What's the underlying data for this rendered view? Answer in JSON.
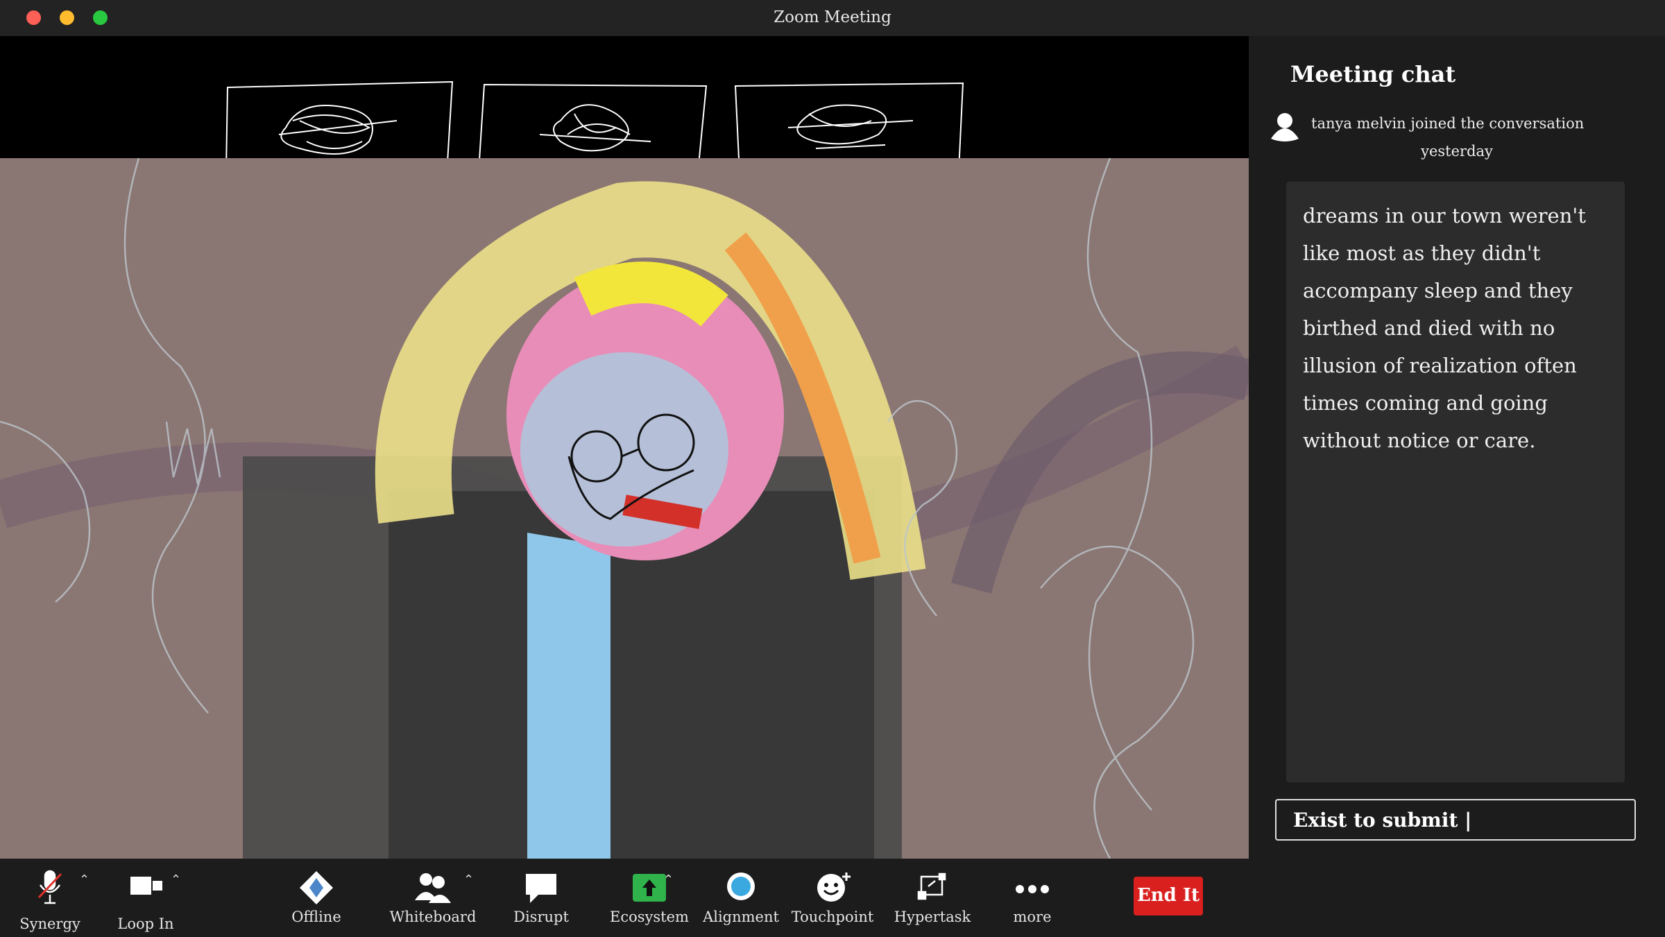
{
  "window": {
    "title": "Zoom Meeting"
  },
  "chat": {
    "title": "Meeting chat",
    "event_text": "tanya melvin  joined the conversation",
    "event_time": "yesterday",
    "message": "dreams in our town weren't like most as they didn't accompany sleep and they birthed and died with no illusion of realization often times coming and going without notice or care.",
    "input_value": "Exist to submit |"
  },
  "toolbar": {
    "items": [
      {
        "label": "Synergy",
        "icon": "muted-microphone-icon"
      },
      {
        "label": "Loop In",
        "icon": "video-camera-icon"
      },
      {
        "label": "Offline",
        "icon": "diamond-share-icon"
      },
      {
        "label": "Whiteboard",
        "icon": "participants-icon"
      },
      {
        "label": "Disrupt",
        "icon": "speech-bubble-icon"
      },
      {
        "label": "Ecosystem",
        "icon": "share-screen-icon"
      },
      {
        "label": "Alignment",
        "icon": "record-icon"
      },
      {
        "label": "Touchpoint",
        "icon": "reactions-icon"
      },
      {
        "label": "Hypertask",
        "icon": "apps-icon"
      },
      {
        "label": "more",
        "icon": "more-dots-icon"
      }
    ],
    "end_label": "End It"
  },
  "colors": {
    "titlebar": "#232323",
    "panel": "#1c1c1c",
    "bubble": "#2c2c2c",
    "end_button": "#d9201f",
    "share_green": "#2fb34a",
    "record_blue": "#3aa9e0",
    "video_bg": "#8a7673"
  }
}
